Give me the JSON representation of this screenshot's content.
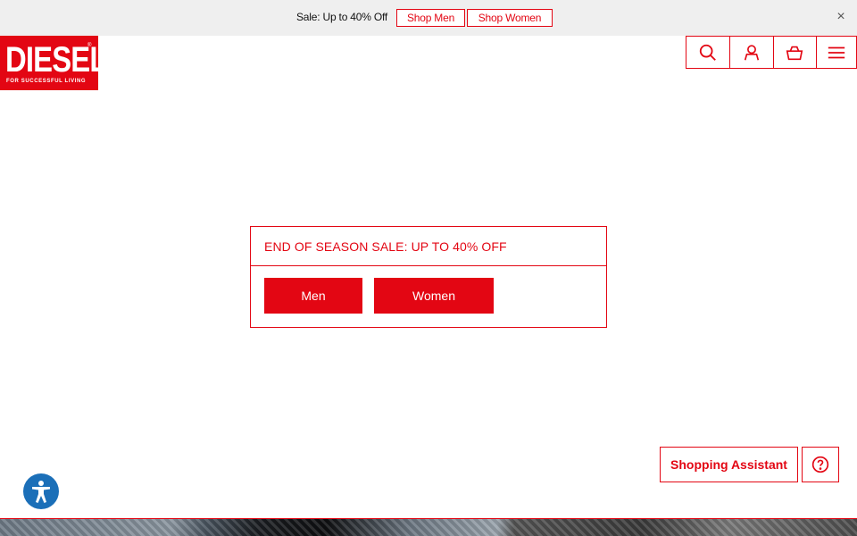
{
  "promo": {
    "text": "Sale: Up to 40% Off",
    "shop_men": "Shop Men",
    "shop_women": "Shop Women",
    "close_glyph": "×"
  },
  "logo": {
    "word": "DIESEL",
    "registered": "®",
    "tagline": "FOR SUCCESSFUL LIVING"
  },
  "header_icons": [
    "search-icon",
    "account-icon",
    "cart-icon",
    "menu-icon"
  ],
  "sale_banner": {
    "title": "END OF SEASON SALE: UP TO 40% OFF",
    "men_label": "Men",
    "women_label": "Women"
  },
  "assistant": {
    "label": "Shopping Assistant",
    "help_icon": "question-circle-icon"
  },
  "accessibility_icon": "accessibility-icon",
  "colors": {
    "brand_red": "#e30613",
    "promo_bg": "#efefef",
    "accessibility_blue": "#1b6fb8"
  }
}
